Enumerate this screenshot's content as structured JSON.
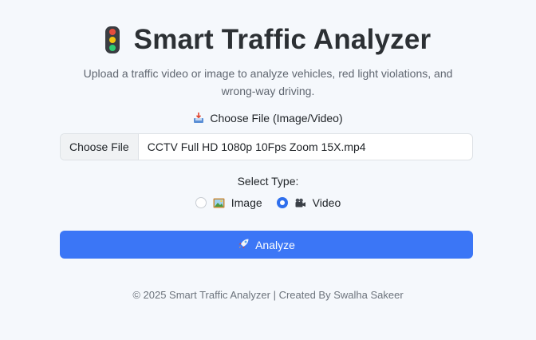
{
  "header": {
    "title": "Smart Traffic Analyzer",
    "subtitle": "Upload a traffic video or image to analyze vehicles, red light violations, and wrong-way driving.",
    "icon": "traffic-light-icon"
  },
  "upload": {
    "label": "Choose File (Image/Video)",
    "icon": "inbox-tray-icon",
    "button_label": "Choose File",
    "file_name": "CCTV Full HD 1080p 10Fps Zoom 15X.mp4"
  },
  "type_select": {
    "label": "Select Type:",
    "options": [
      {
        "label": "Image",
        "icon": "framed-picture-icon",
        "selected": false
      },
      {
        "label": "Video",
        "icon": "movie-camera-icon",
        "selected": true
      }
    ]
  },
  "analyze": {
    "label": "Analyze",
    "icon": "rocket-icon"
  },
  "footer": {
    "text": "© 2025 Smart Traffic Analyzer | Created By Swalha Sakeer"
  },
  "colors": {
    "background": "#f5f8fc",
    "accent": "#3b76f6",
    "title": "#2c3034"
  }
}
